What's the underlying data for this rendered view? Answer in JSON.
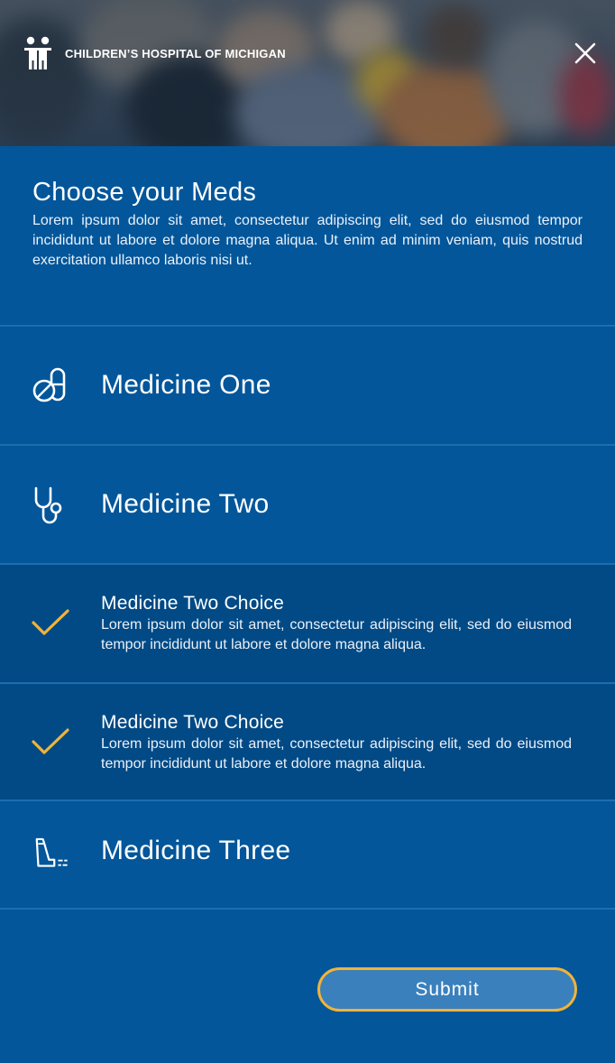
{
  "header": {
    "hospital_name": "CHILDREN’S HOSPITAL OF MICHIGAN",
    "logo_icon": "children-figures-icon",
    "close_icon": "close-icon"
  },
  "intro": {
    "title": "Choose your Meds",
    "description": "Lorem ipsum dolor sit amet, consectetur adipiscing elit, sed do eiusmod tempor incididunt ut labore et dolore magna aliqua. Ut enim ad minim veniam, quis nostrud exercitation ullamco laboris nisi ut."
  },
  "medicines": [
    {
      "label": "Medicine One",
      "icon": "pills-icon"
    },
    {
      "label": "Medicine Two",
      "icon": "stethoscope-icon"
    },
    {
      "label": "Medicine Three",
      "icon": "inhaler-icon"
    }
  ],
  "choices": [
    {
      "title": "Medicine Two Choice",
      "description": "Lorem ipsum dolor sit amet, consectetur adipiscing elit, sed do eiusmod tempor incididunt ut labore et dolore magna aliqua.",
      "checked": true,
      "icon": "checkmark-icon"
    },
    {
      "title": "Medicine Two Choice",
      "description": "Lorem ipsum dolor sit amet, consectetur adipiscing elit, sed do eiusmod tempor incididunt ut labore et dolore magna aliqua.",
      "checked": true,
      "icon": "checkmark-icon"
    }
  ],
  "submit_label": "Submit",
  "colors": {
    "background": "#03569a",
    "selected_row": "#024a85",
    "divider": "#1c6eae",
    "accent": "#f0b43a",
    "button_fill": "#3a80bd"
  }
}
